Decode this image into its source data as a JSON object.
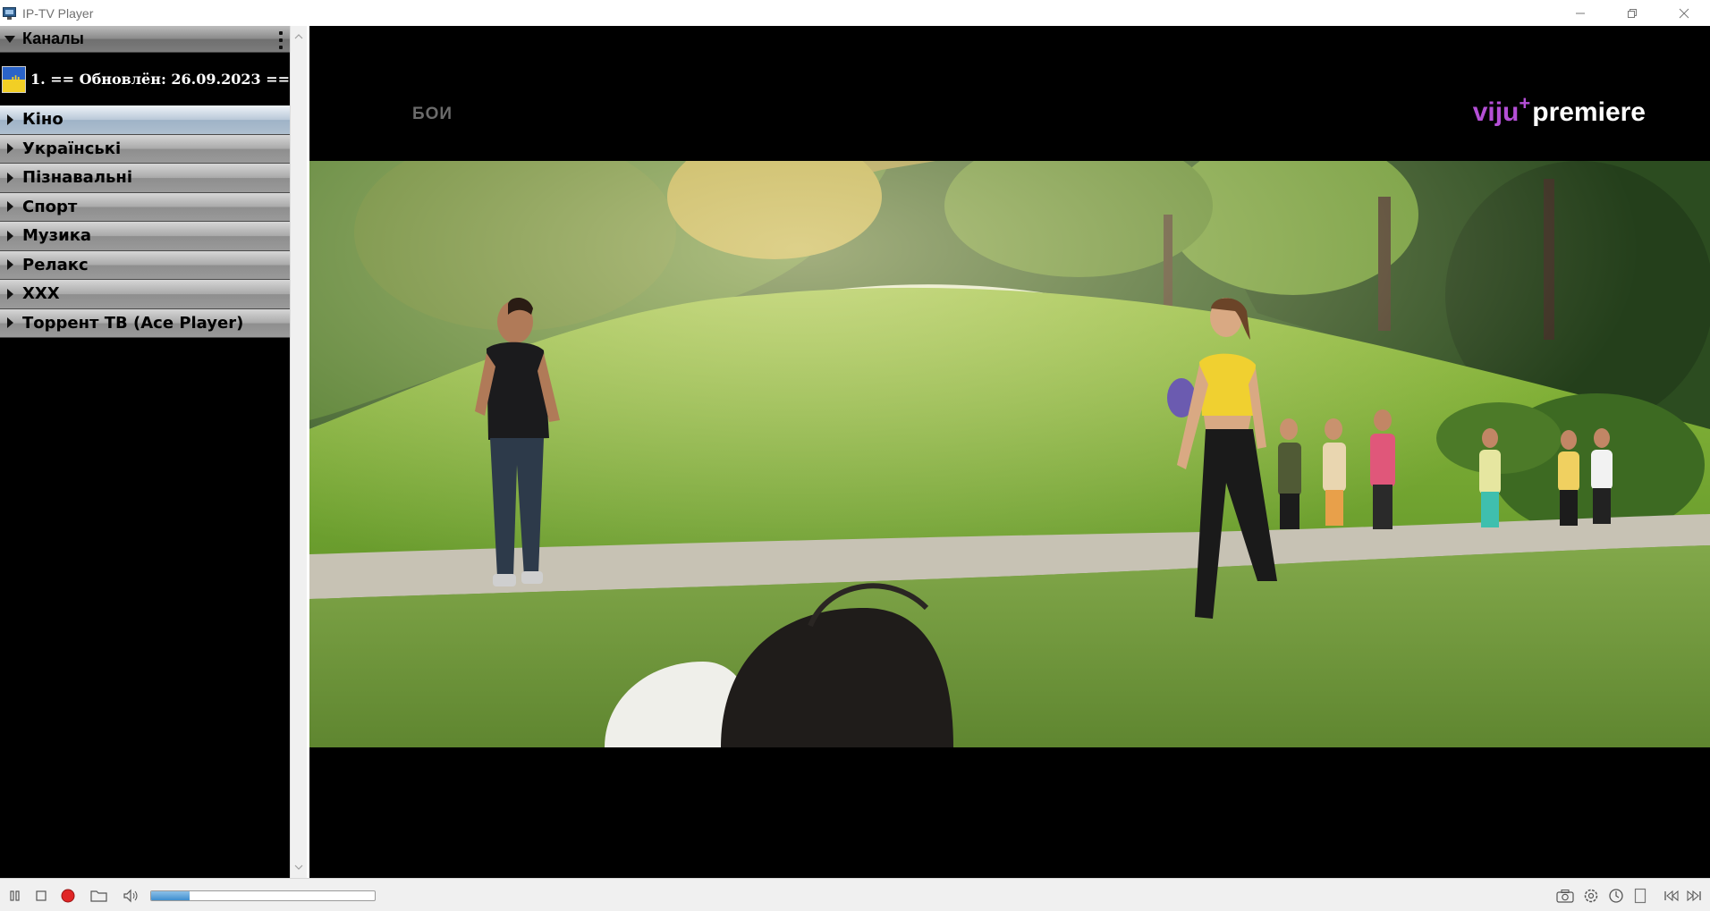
{
  "window": {
    "title": "IP-TV Player"
  },
  "sidebar": {
    "header_label": "Каналы",
    "current_channel": "1. == Обновлён: 26.09.2023 ==",
    "categories": [
      {
        "label": "Кіно"
      },
      {
        "label": "Українські"
      },
      {
        "label": "Пізнавальні"
      },
      {
        "label": "Спорт"
      },
      {
        "label": "Музика"
      },
      {
        "label": "Релакс"
      },
      {
        "label": "XXX"
      },
      {
        "label": "Торрент ТВ (Ace Player)"
      }
    ]
  },
  "video": {
    "channel_bug": "БОИ",
    "brand_part1": "viju",
    "brand_plus": "+",
    "brand_part2": "premiere"
  },
  "controls": {
    "volume_fraction": 0.17,
    "icons": [
      "pause-icon",
      "stop-icon",
      "record-icon",
      "open-folder-icon",
      "volume-icon",
      "camera-icon",
      "settings-icon",
      "clock-icon",
      "fullscreen-icon",
      "prev-icon",
      "next-icon"
    ]
  },
  "colors": {
    "brand_purple": "#b44fd6",
    "record_red": "#e02626",
    "progress_blue": "#3f8fcf"
  }
}
